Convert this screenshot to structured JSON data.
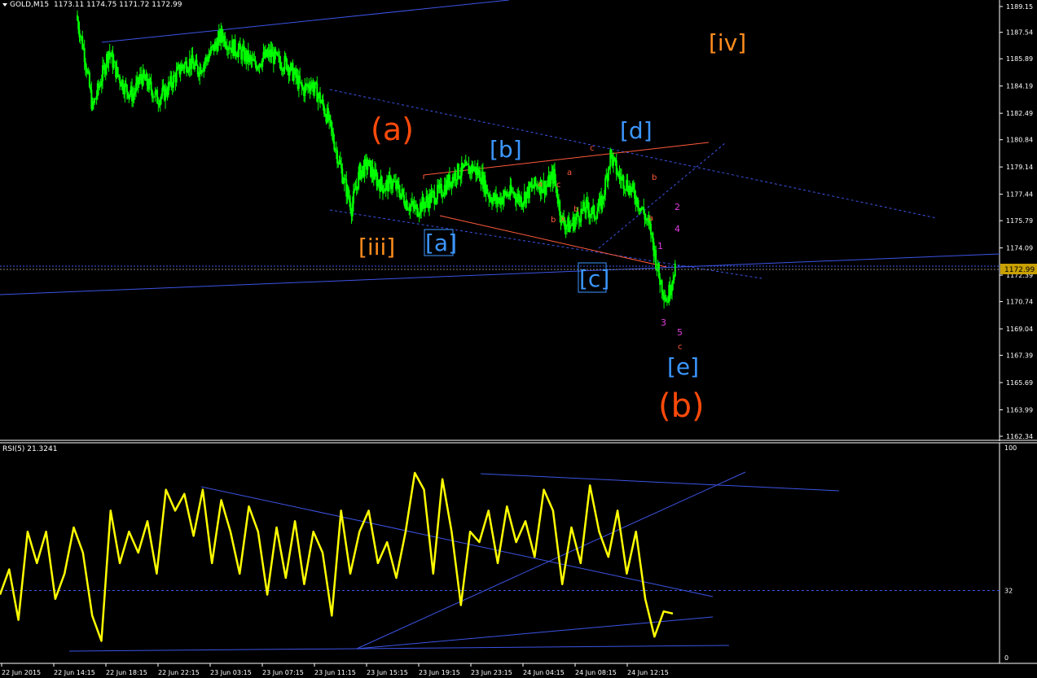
{
  "window": {
    "symbol_title": "GOLD,M15",
    "ohlc_text": "1173.11 1174.75 1171.72 1172.99",
    "rsi_title": "RSI(5) 21.3241",
    "current_price_label": "1172.99"
  },
  "colors": {
    "background": "#000000",
    "candle": "#00ff00",
    "rsi_line": "#ffff00",
    "trendline": "#3c54e6",
    "dashed_trendline": "#3c54e6",
    "orange_trendline": "#ff5a3c",
    "label_orange_red": "#ff4a0a",
    "label_orange": "#ff8c1e",
    "label_blue": "#3c96ff",
    "label_magenta": "#e040e0",
    "label_small_red": "#ff5a3c",
    "axis_text": "#ffffff",
    "grid_dotted": "#3c54e6"
  },
  "chart_data": [
    {
      "type": "candlestick",
      "title": "GOLD,M15",
      "ylim": [
        1162.34,
        1189.15
      ],
      "price_axis_ticks": [
        "1189.15",
        "1187.54",
        "1185.89",
        "1184.19",
        "1182.49",
        "1180.84",
        "1179.14",
        "1177.44",
        "1175.79",
        "1174.09",
        "1172.39",
        "1170.74",
        "1169.04",
        "1167.39",
        "1165.69",
        "1163.99",
        "1162.34"
      ],
      "current_price": 1172.99,
      "time_axis_ticks": [
        "22 Jun 2015",
        "22 Jun 14:15",
        "22 Jun 18:15",
        "22 Jun 22:15",
        "23 Jun 03:15",
        "23 Jun 07:15",
        "23 Jun 11:15",
        "23 Jun 15:15",
        "23 Jun 19:15",
        "23 Jun 23:15",
        "24 Jun 04:15",
        "24 Jun 08:15",
        "24 Jun 12:15"
      ],
      "close_path": [
        [
          0,
          1188.6
        ],
        [
          1,
          1186.2
        ],
        [
          2,
          1182.8
        ],
        [
          3,
          1184.5
        ],
        [
          4,
          1186.4
        ],
        [
          5,
          1185.0
        ],
        [
          6,
          1184.1
        ],
        [
          7,
          1183.6
        ],
        [
          8,
          1184.8
        ],
        [
          9,
          1184.2
        ],
        [
          10,
          1183.4
        ],
        [
          11,
          1183.8
        ],
        [
          12,
          1184.6
        ],
        [
          13,
          1185.4
        ],
        [
          14,
          1185.7
        ],
        [
          15,
          1185.2
        ],
        [
          16,
          1185.8
        ],
        [
          17,
          1186.6
        ],
        [
          18,
          1187.4
        ],
        [
          19,
          1186.7
        ],
        [
          20,
          1186.4
        ],
        [
          21,
          1186.0
        ],
        [
          22,
          1185.5
        ],
        [
          23,
          1185.9
        ],
        [
          24,
          1186.2
        ],
        [
          25,
          1185.7
        ],
        [
          26,
          1185.6
        ],
        [
          27,
          1184.8
        ],
        [
          28,
          1183.9
        ],
        [
          29,
          1184.4
        ],
        [
          30,
          1183.5
        ],
        [
          31,
          1182.3
        ],
        [
          32,
          1180.4
        ],
        [
          33,
          1178.4
        ],
        [
          34,
          1176.6
        ],
        [
          35,
          1178.8
        ],
        [
          36,
          1179.3
        ],
        [
          37,
          1178.4
        ],
        [
          38,
          1177.9
        ],
        [
          39,
          1178.2
        ],
        [
          40,
          1177.6
        ],
        [
          41,
          1176.8
        ],
        [
          42,
          1176.5
        ],
        [
          43,
          1176.9
        ],
        [
          44,
          1177.3
        ],
        [
          45,
          1177.6
        ],
        [
          46,
          1178.2
        ],
        [
          47,
          1178.8
        ],
        [
          48,
          1178.9
        ],
        [
          49,
          1179.1
        ],
        [
          50,
          1178.6
        ],
        [
          51,
          1177.4
        ],
        [
          52,
          1177.0
        ],
        [
          53,
          1177.4
        ],
        [
          54,
          1177.5
        ],
        [
          55,
          1177.1
        ],
        [
          56,
          1177.7
        ],
        [
          57,
          1178.1
        ],
        [
          58,
          1177.9
        ],
        [
          59,
          1178.6
        ],
        [
          60,
          1175.8
        ],
        [
          61,
          1175.4
        ],
        [
          62,
          1176.1
        ],
        [
          63,
          1176.6
        ],
        [
          64,
          1176.2
        ],
        [
          65,
          1177.0
        ],
        [
          66,
          1179.9
        ],
        [
          67,
          1178.6
        ],
        [
          68,
          1178.1
        ],
        [
          69,
          1177.4
        ],
        [
          70,
          1176.4
        ],
        [
          71,
          1175.1
        ],
        [
          72,
          1172.3
        ],
        [
          73,
          1170.8
        ],
        [
          74,
          1173.0
        ]
      ]
    },
    {
      "type": "line",
      "title": "RSI(5) 21.3241",
      "ylim": [
        0,
        100
      ],
      "level_line": 32,
      "axis_ticks": [
        "100",
        "32",
        "0"
      ],
      "series": [
        {
          "name": "RSI(5)",
          "values": [
            30,
            42,
            18,
            60,
            45,
            60,
            28,
            40,
            62,
            50,
            20,
            8,
            70,
            45,
            60,
            50,
            65,
            40,
            80,
            70,
            78,
            58,
            80,
            45,
            75,
            60,
            40,
            72,
            60,
            30,
            62,
            38,
            65,
            35,
            60,
            50,
            20,
            70,
            40,
            60,
            70,
            45,
            55,
            38,
            60,
            88,
            80,
            40,
            85,
            60,
            25,
            60,
            55,
            70,
            45,
            72,
            55,
            65,
            48,
            80,
            70,
            35,
            62,
            45,
            82,
            60,
            48,
            70,
            40,
            60,
            28,
            10,
            22,
            21
          ]
        }
      ]
    }
  ],
  "annotations": {
    "wave_iv": "[iv]",
    "wave_a_big": "(a)",
    "wave_iii": "[iii]",
    "wave_b_bracket": "[b]",
    "wave_d": "[d]",
    "wave_a_bracket": "[a]",
    "wave_c_bracket": "[c]",
    "wave_e": "[e]",
    "wave_b_big": "(b)",
    "small_labels": [
      "c",
      "a",
      "a",
      "c",
      "b",
      "x",
      "b",
      "a",
      "b",
      "a",
      "c"
    ],
    "magenta_labels": [
      "2",
      "4",
      "1",
      "3",
      "5"
    ]
  }
}
